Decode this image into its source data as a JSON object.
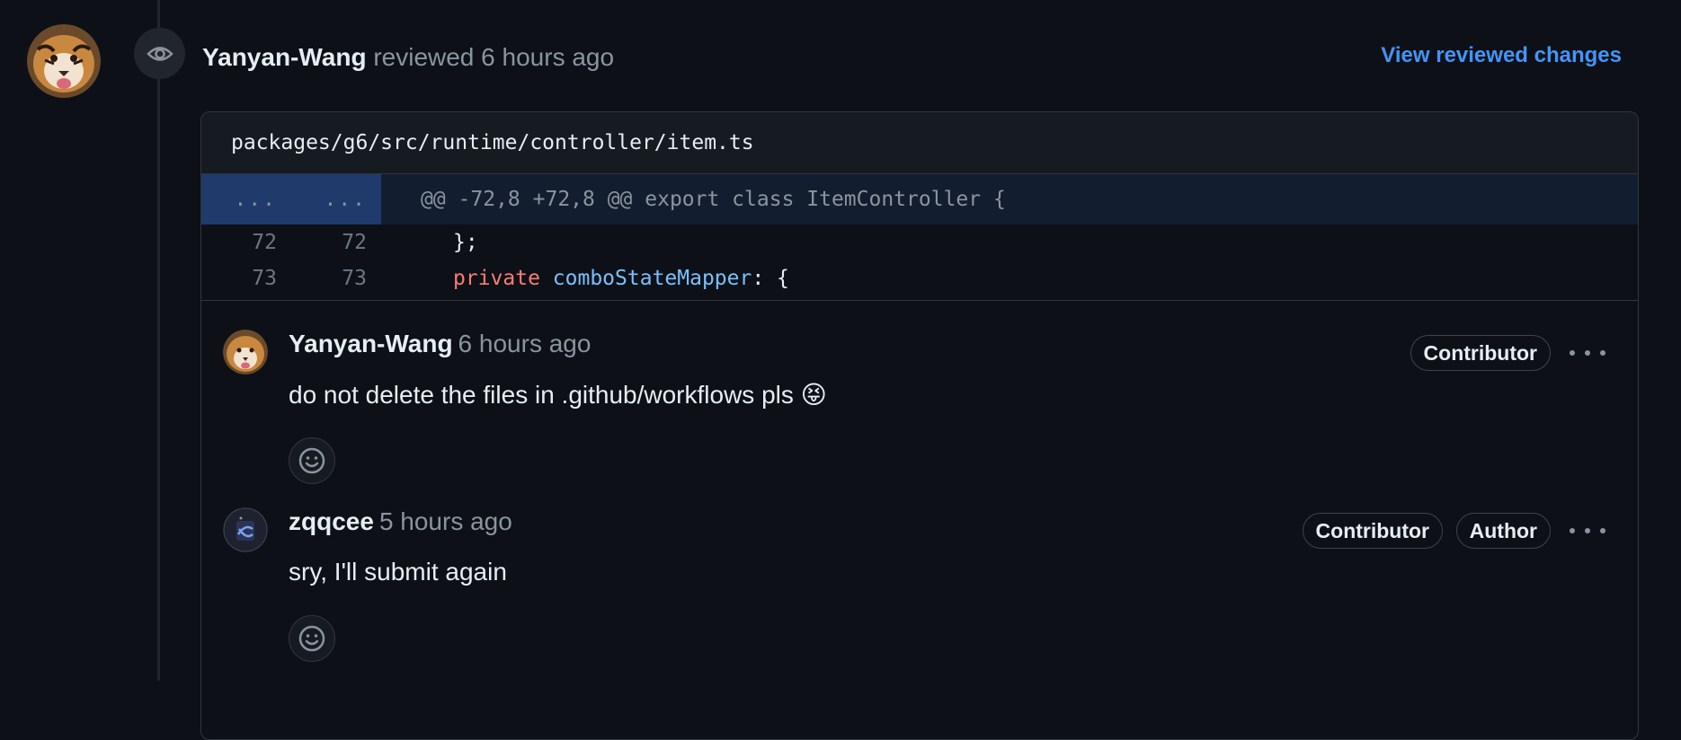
{
  "review": {
    "author": "Yanyan-Wang",
    "action": "reviewed",
    "time": "6 hours ago",
    "view_changes_label": "View reviewed changes"
  },
  "file": {
    "path": "packages/g6/src/runtime/controller/item.ts",
    "hunk": {
      "left_num": "...",
      "right_num": "...",
      "header": "@@ -72,8 +72,8 @@ export class ItemController {"
    },
    "lines": [
      {
        "left": "72",
        "right": "72",
        "code": "};"
      },
      {
        "left": "73",
        "right": "73",
        "keyword": "private",
        "ident": "comboStateMapper",
        "rest": ": {"
      }
    ]
  },
  "comments": [
    {
      "author": "Yanyan-Wang",
      "time": "6 hours ago",
      "body": "do not delete the files in .github/workflows pls 😝",
      "badges": [
        "Contributor"
      ]
    },
    {
      "author": "zqqcee",
      "time": "5 hours ago",
      "body": "sry, I'll submit again",
      "badges": [
        "Contributor",
        "Author"
      ]
    }
  ],
  "colors": {
    "background": "#0d1117",
    "link": "#4493f8",
    "hunk_bg": "#121d2f",
    "hunk_num_bg": "#1f3a6b",
    "keyword": "#ff7b72",
    "identifier": "#79c0ff"
  },
  "icons": [
    "eye-icon",
    "smiley-icon",
    "kebab-icon"
  ]
}
